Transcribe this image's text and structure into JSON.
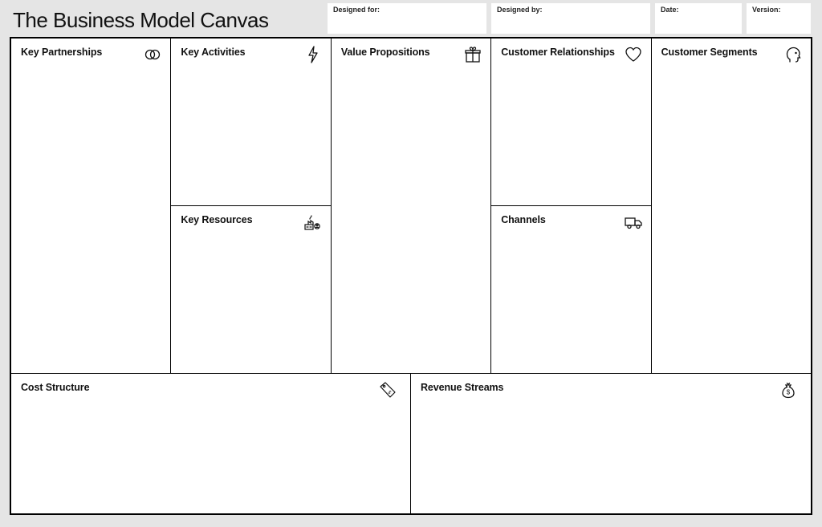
{
  "title": "The Business Model Canvas",
  "meta": {
    "designed_for_label": "Designed for:",
    "designed_by_label": "Designed by:",
    "date_label": "Date:",
    "version_label": "Version:"
  },
  "blocks": {
    "key_partnerships": "Key Partnerships",
    "key_activities": "Key Activities",
    "key_resources": "Key Resources",
    "value_propositions": "Value Propositions",
    "customer_relationships": "Customer Relationships",
    "channels": "Channels",
    "customer_segments": "Customer Segments",
    "cost_structure": "Cost Structure",
    "revenue_streams": "Revenue Streams"
  }
}
